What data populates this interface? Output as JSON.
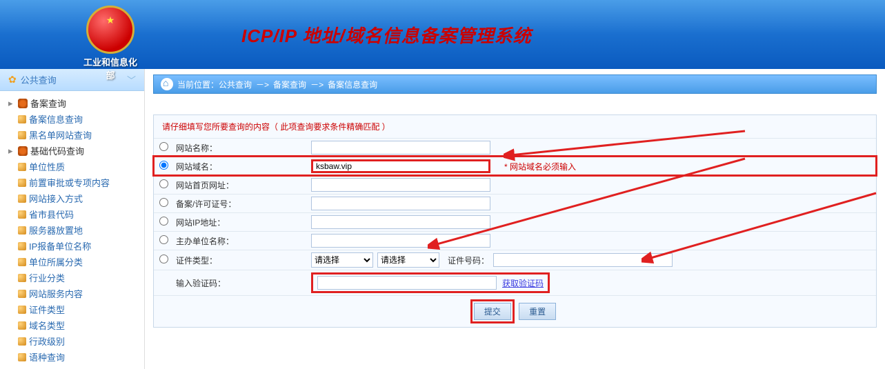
{
  "header": {
    "org_label": "工业和信息化部",
    "title": "ICP/IP 地址/域名信息备案管理系统"
  },
  "sidebar": {
    "section_title": "公共查询",
    "groups": [
      {
        "label": "备案查询",
        "items": [
          "备案信息查询",
          "黑名单网站查询"
        ]
      },
      {
        "label": "基础代码查询",
        "items": [
          "单位性质",
          "前置审批或专项内容",
          "网站接入方式",
          "省市县代码",
          "服务器放置地",
          "IP报备单位名称",
          "单位所属分类",
          "行业分类",
          "网站服务内容",
          "证件类型",
          "域名类型",
          "行政级别",
          "语种查询"
        ]
      }
    ]
  },
  "breadcrumb": {
    "prefix": "当前位置：",
    "items": [
      "公共查询",
      "备案查询",
      "备案信息查询"
    ],
    "sep": "－>"
  },
  "form": {
    "hint": "请仔细填写您所要查询的内容（ 此项查询要求条件精确匹配 ）",
    "rows": [
      {
        "key": "site_name",
        "label": "网站名称：",
        "value": ""
      },
      {
        "key": "site_domain",
        "label": "网站域名：",
        "value": "ksbaw.vip",
        "note": "* 网站域名必须输入",
        "checked": true,
        "highlight": true
      },
      {
        "key": "site_homepage",
        "label": "网站首页网址：",
        "value": ""
      },
      {
        "key": "record_no",
        "label": "备案/许可证号：",
        "value": ""
      },
      {
        "key": "ip_addr",
        "label": "网站IP地址：",
        "value": ""
      },
      {
        "key": "org_name",
        "label": "主办单位名称：",
        "value": ""
      }
    ],
    "cert_row": {
      "label": "证件类型：",
      "select_placeholder": "请选择",
      "cert_no_label": "证件号码："
    },
    "captcha_row": {
      "label": "输入验证码：",
      "link": "获取验证码"
    },
    "submit": "提交",
    "reset": "重置"
  }
}
